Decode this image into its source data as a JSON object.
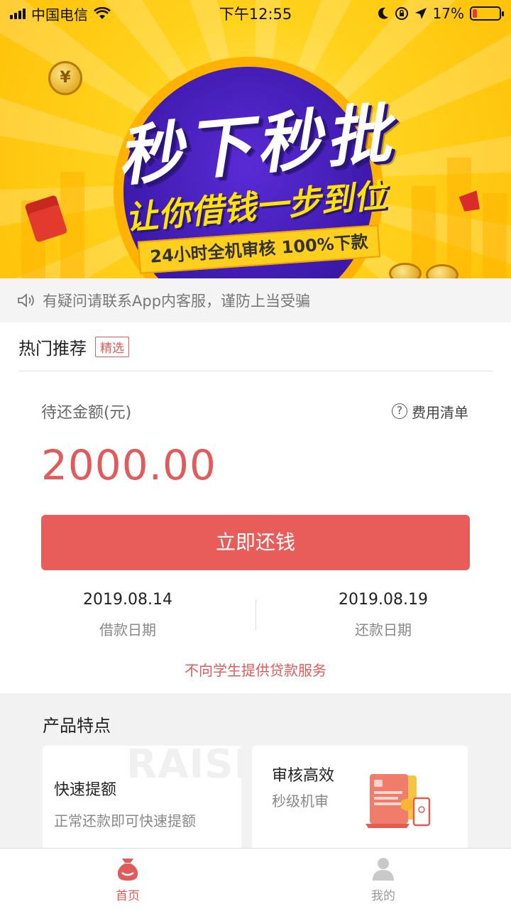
{
  "status_bar": {
    "carrier": "中国电信",
    "time": "下午12:55",
    "battery": "17%",
    "battery_level": 0.17
  },
  "banner": {
    "title": "秒下秒批",
    "subtitle": "让你借钱一步到位",
    "ribbon": "24小时全机审核 100%下款"
  },
  "notice": {
    "text": "有疑问请联系App内客服，谨防上当受骗"
  },
  "section": {
    "title": "热门推荐",
    "tag": "精选"
  },
  "loan": {
    "amount_label": "待还金额(元)",
    "fee_link": "费用清单",
    "amount": "2000.00",
    "repay_button": "立即还钱",
    "borrow_date": "2019.08.14",
    "borrow_date_label": "借款日期",
    "repay_date": "2019.08.19",
    "repay_date_label": "还款日期",
    "student_notice": "不向学生提供贷款服务"
  },
  "features": {
    "title": "产品特点",
    "watermark": "RAISE",
    "cards": [
      {
        "title": "快速提额",
        "desc": "正常还款即可快速提额"
      },
      {
        "title": "审核高效",
        "desc": "秒级机审"
      }
    ]
  },
  "tabbar": {
    "tabs": [
      {
        "label": "首页"
      },
      {
        "label": "我的"
      }
    ]
  },
  "colors": {
    "accent": "#e85c5a",
    "banner_yellow": "#ffd21c",
    "banner_purple": "#3b18a8"
  }
}
